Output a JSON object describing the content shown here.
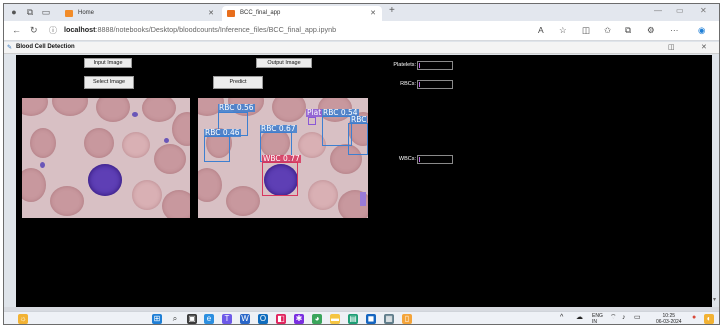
{
  "browser": {
    "tabs": [
      {
        "label": "Home",
        "active": false
      },
      {
        "label": "BCC_final_app",
        "active": true
      }
    ],
    "url_host": "localhost",
    "url_rest": ":8888/notebooks/Desktop/bloodcounts/Inference_files/BCC_final_app.ipynb",
    "new_tab_symbol": "+",
    "more_symbol": "···"
  },
  "app": {
    "title": "Blood Cell Detection",
    "input_image_label": "Input Image",
    "output_image_label": "Output Image",
    "select_image_button": "Select Image",
    "predict_button": "Predict",
    "platelets_label": "Platelets:",
    "rbcs_label": "RBCs:",
    "wbcs_label": "WBCs:",
    "platelets_value": "",
    "rbcs_value": "",
    "wbcs_value": ""
  },
  "detections": [
    {
      "label": "RBC 0.56",
      "class": "RBC"
    },
    {
      "label": "Plat",
      "class": "Platelets"
    },
    {
      "label": "RBC 0.54",
      "class": "RBC"
    },
    {
      "label": "RBC",
      "class": "RBC"
    },
    {
      "label": "RBC 0.46",
      "class": "RBC"
    },
    {
      "label": "RBC 0.67",
      "class": "RBC"
    },
    {
      "label": "WBC 0.77",
      "class": "WBC"
    }
  ],
  "taskbar": {
    "language": "ENG",
    "region": "IN",
    "time": "10:25",
    "date": "06-03-2024"
  },
  "colors": {
    "app_background": "#000000",
    "rbc_box": "#3d7fd0",
    "wbc_box": "#d8355e",
    "platelet_box": "#8a58d6"
  }
}
